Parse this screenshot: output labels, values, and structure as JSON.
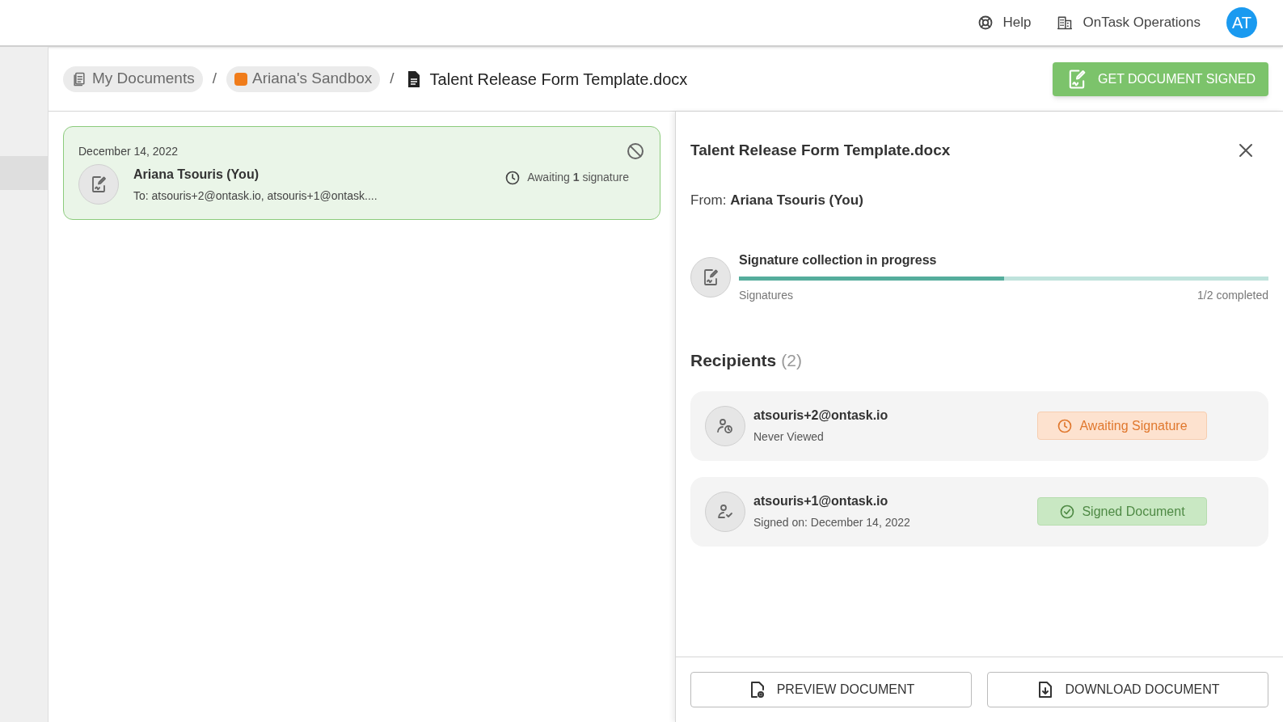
{
  "header": {
    "help": "Help",
    "organization": "OnTask Operations",
    "avatar": "AT"
  },
  "breadcrumb": [
    {
      "kind": "folder",
      "label": "My Documents",
      "color": "#6b6b6b"
    },
    {
      "kind": "workspace",
      "label": "Ariana's Sandbox",
      "color": "#f07c1a"
    },
    {
      "kind": "file",
      "label": "Talent Release Form Template.docx",
      "color": "#222222"
    }
  ],
  "breadcrumb_separator": "/",
  "primary_action": "GET DOCUMENT SIGNED",
  "documents": [
    {
      "date": "December 14, 2022",
      "sender": "Ariana Tsouris (You)",
      "to": "To: atsouris+2@ontask.io, atsouris+1@ontask....",
      "status": "Awaiting **1** signature",
      "selected": true
    }
  ],
  "detail": {
    "title": "Talent Release Form Template.docx",
    "from_label": "From:",
    "from": "Ariana Tsouris (You)",
    "progress": {
      "title": "Signature collection in progress",
      "label": "Signatures",
      "reading": "1/2 completed",
      "level": 0.5
    },
    "recipients_title": "Recipients",
    "recipients_count": "(2)",
    "recipients": [
      {
        "email": "atsouris+2@ontask.io",
        "note": "Never Viewed",
        "kind": "awaiting",
        "status": "Awaiting Signature"
      },
      {
        "email": "atsouris+1@ontask.io",
        "note": "Signed on: December 14, 2022",
        "kind": "signed",
        "status": "Signed Document"
      }
    ],
    "buttons": [
      {
        "kind": "preview",
        "label": "PREVIEW DOCUMENT"
      },
      {
        "kind": "download",
        "label": "DOWNLOAD DOCUMENT"
      }
    ]
  }
}
